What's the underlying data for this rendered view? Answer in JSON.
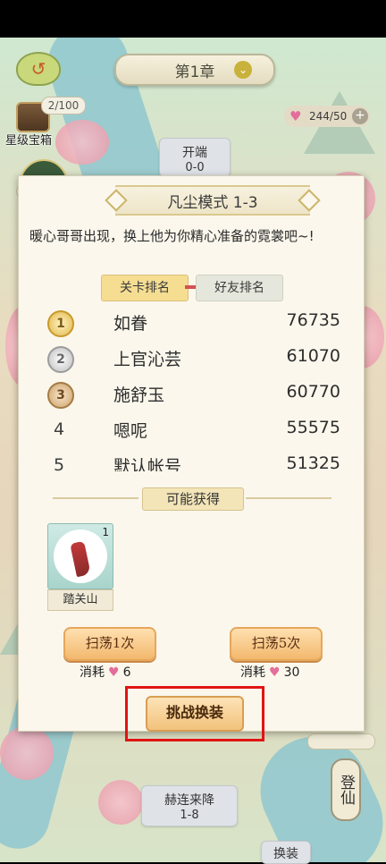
{
  "header": {
    "chapter_title": "第1章"
  },
  "left_panel": {
    "chest_progress": "2/100",
    "chest_label": "星级宝箱"
  },
  "resources": {
    "hearts": "244/50"
  },
  "map_nodes": {
    "top": {
      "title": "开端",
      "stage": "0-0"
    },
    "bottom": {
      "title": "赫连来降",
      "stage": "1-8"
    },
    "bottom_right": {
      "title": "换装"
    }
  },
  "side": {
    "dengxian_label": "登仙"
  },
  "dialog": {
    "title": "凡尘模式 1-3",
    "description": "暖心哥哥出现，换上他为你精心准备的霓裳吧~!",
    "tabs": [
      {
        "label": "关卡排名",
        "active": true
      },
      {
        "label": "好友排名",
        "active": false
      }
    ],
    "rankings": [
      {
        "rank": "1",
        "name": "如眷",
        "score": "76735",
        "medal": "gold"
      },
      {
        "rank": "2",
        "name": "上官沁芸",
        "score": "61070",
        "medal": "silver"
      },
      {
        "rank": "3",
        "name": "施舒玉",
        "score": "60770",
        "medal": "bronze"
      },
      {
        "rank": "4",
        "name": "嗯呢",
        "score": "55575",
        "medal": "none"
      },
      {
        "rank": "5",
        "name": "默认帐号",
        "score": "51325",
        "medal": "none"
      }
    ],
    "rewards_header": "可能获得",
    "reward_item": {
      "name": "踏关山",
      "count": "1"
    },
    "sweep_once": {
      "label": "扫荡1次",
      "cost_label": "消耗",
      "cost": "6"
    },
    "sweep_five": {
      "label": "扫荡5次",
      "cost_label": "消耗",
      "cost": "30"
    },
    "challenge_label": "挑战换装"
  },
  "colors": {
    "highlight_box": "#e01414",
    "accent_gold": "#f5dd92",
    "heart": "#e46e9b"
  }
}
